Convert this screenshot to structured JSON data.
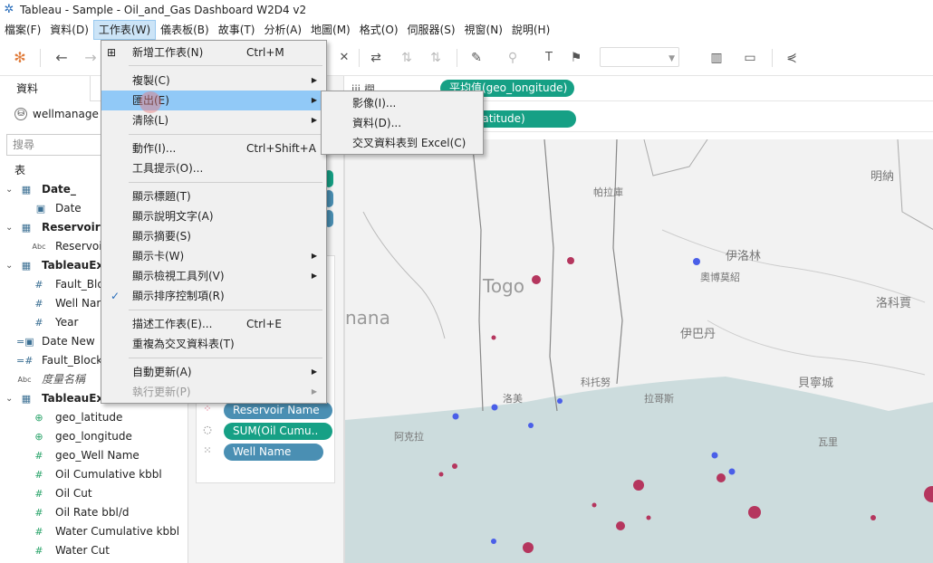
{
  "window": {
    "title": "Tableau - Sample - Oil_and_Gas Dashboard W2D4 v2"
  },
  "menubar": [
    "檔案(F)",
    "資料(D)",
    "工作表(W)",
    "儀表板(B)",
    "故事(T)",
    "分析(A)",
    "地圖(M)",
    "格式(O)",
    "伺服器(S)",
    "視窗(N)",
    "說明(H)"
  ],
  "worksheet_menu": {
    "items": [
      {
        "label": "新增工作表(N)",
        "shortcut": "Ctrl+M"
      },
      {
        "label": "複製(C)"
      },
      {
        "label": "匯出(E)"
      },
      {
        "label": "清除(L)"
      },
      {
        "label": "動作(I)...",
        "shortcut": "Ctrl+Shift+A"
      },
      {
        "label": "工具提示(O)..."
      },
      {
        "label": "顯示標題(T)"
      },
      {
        "label": "顯示說明文字(A)"
      },
      {
        "label": "顯示摘要(S)"
      },
      {
        "label": "顯示卡(W)"
      },
      {
        "label": "顯示檢視工具列(V)"
      },
      {
        "label": "顯示排序控制項(R)"
      },
      {
        "label": "描述工作表(E)...",
        "shortcut": "Ctrl+E"
      },
      {
        "label": "重複為交叉資料表(T)"
      },
      {
        "label": "自動更新(A)"
      },
      {
        "label": "執行更新(P)"
      }
    ]
  },
  "export_submenu": [
    "影像(I)...",
    "資料(D)...",
    "交叉資料表到 Excel(C)"
  ],
  "data_pane": {
    "tab_data": "資料",
    "datasource": "wellmanage",
    "search_placeholder": "搜尋",
    "tables_header": "表",
    "rows": [
      {
        "label": "Date_"
      },
      {
        "label": "Date"
      },
      {
        "label": "Reservoir N"
      },
      {
        "label": "Reservoi"
      },
      {
        "label": "TableauExt"
      },
      {
        "label": "Fault_Blo"
      },
      {
        "label": "Well Nar"
      },
      {
        "label": "Year"
      },
      {
        "label": "Date New"
      },
      {
        "label": "Fault_Block"
      },
      {
        "label": "度量名稱"
      },
      {
        "label": "TableauExtract"
      },
      {
        "label": "geo_latitude"
      },
      {
        "label": "geo_longitude"
      },
      {
        "label": "geo_Well Name"
      },
      {
        "label": "Oil Cumulative kbbl"
      },
      {
        "label": "Oil Cut"
      },
      {
        "label": "Oil Rate bbl/d"
      },
      {
        "label": "Water Cumulative kbbl"
      },
      {
        "label": "Water Cut"
      }
    ]
  },
  "marks": {
    "pills": [
      "Reservoir Name",
      "SUM(Oil Cumu..",
      "Well Name"
    ]
  },
  "shelves": {
    "columns_pill": "平均值(geo_longitude)",
    "rows_pill": "(geo_latitude)"
  },
  "map_labels": [
    "Togo",
    "nana",
    "帕拉庫",
    "伊洛林",
    "奧博莫紹",
    "洛科賈",
    "伊巴丹",
    "科托努",
    "拉哥斯",
    "洛美",
    "阿克拉",
    "貝寧城",
    "瓦里",
    "明納"
  ],
  "colors": {
    "accent_green": "#16a085",
    "accent_blue": "#4a8fb3",
    "sea": "#ccdcdd",
    "dot_red": "#b5365e",
    "dot_blue": "#4a5fe8"
  }
}
